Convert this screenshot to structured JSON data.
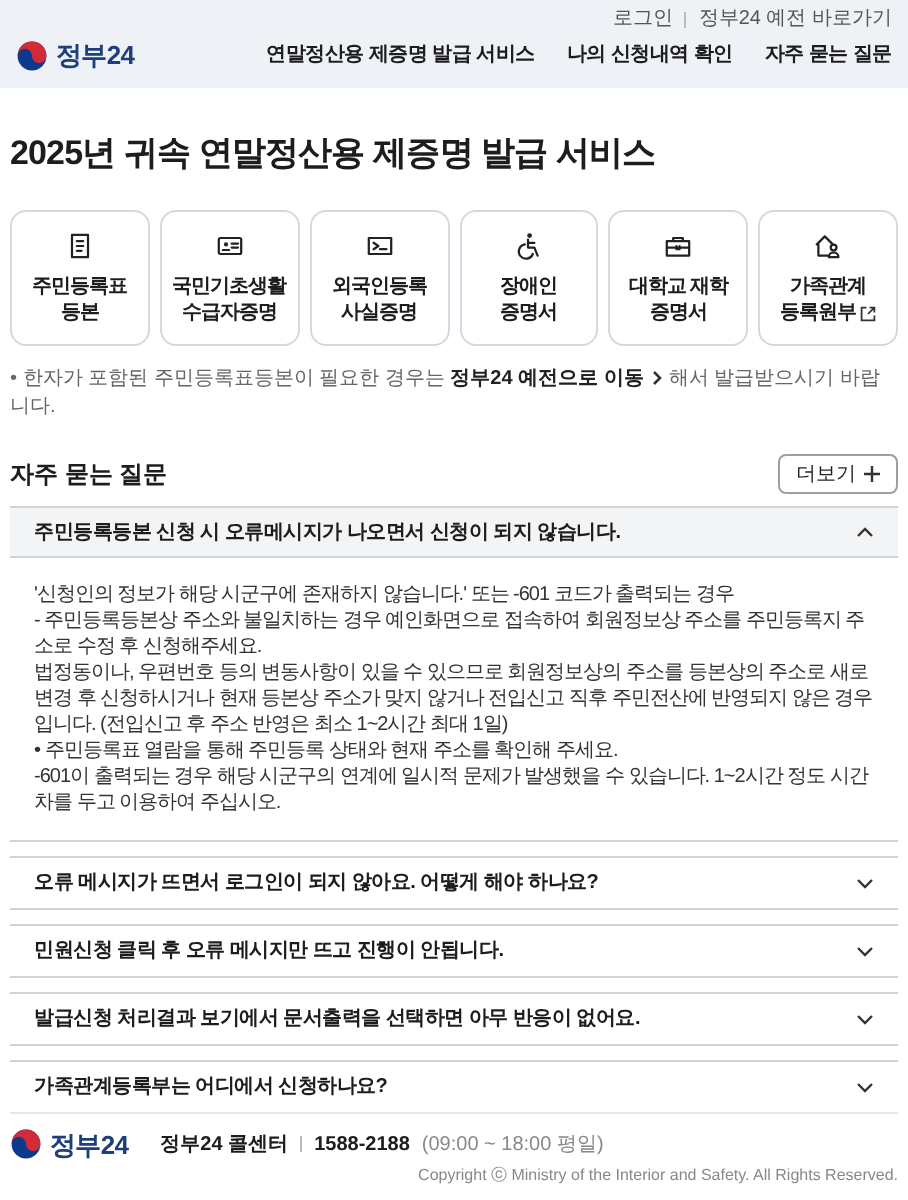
{
  "header": {
    "logo": "정부24",
    "nav": [
      {
        "label": "연말정산용 제증명 발급 서비스"
      },
      {
        "label": "나의 신청내역 확인"
      },
      {
        "label": "자주 묻는 질문"
      }
    ],
    "utility_links": [
      "로그인",
      "정부24 예전 바로가기"
    ]
  },
  "page_title": "2025년 귀속 연말정산용 제증명 발급 서비스",
  "services": [
    {
      "lines": [
        "주민등록표",
        "등본"
      ],
      "external": false
    },
    {
      "lines": [
        "국민기초생활",
        "수급자증명"
      ],
      "external": false
    },
    {
      "lines": [
        "외국인등록",
        "사실증명"
      ],
      "external": false
    },
    {
      "lines": [
        "장애인",
        "증명서"
      ],
      "external": false
    },
    {
      "lines": [
        "대학교 재학",
        "증명서"
      ],
      "external": false
    },
    {
      "lines": [
        "가족관계",
        "등록원부"
      ],
      "external": true
    }
  ],
  "notice": {
    "before": "• 한자가 포함된 주민등록표등본이 필요한 경우는",
    "link": "정부24 예전으로 이동",
    "after": "해서 발급받으시기 바랍니다."
  },
  "faq": {
    "title": "자주 묻는 질문",
    "more_button": "더보기",
    "items": [
      {
        "question": "주민등록등본 신청 시 오류메시지가 나오면서 신청이 되지 않습니다.",
        "expanded": true,
        "answer": [
          "'신청인의 정보가 해당 시군구에 존재하지 않습니다.' 또는 -601 코드가 출력되는 경우",
          " - 주민등록등본상 주소와 불일치하는 경우 예인화면으로 접속하여 회원정보상 주소를 주민등록지 주소로 수정 후 신청해주세요.",
          "법정동이나, 우편번호 등의 변동사항이 있을 수 있으므로 회원정보상의 주소를 등본상의 주소로 새로 변경 후 신청하시거나 현재 등본상 주소가 맞지 않거나 전입신고 직후 주민전산에 반영되지 않은 경우입니다. (전입신고 후 주소 반영은 최소 1~2시간 최대 1일)",
          "• 주민등록표 열람을 통해 주민등록 상태와 현재 주소를 확인해 주세요.",
          "-601이 출력되는 경우 해당 시군구의 연계에 일시적 문제가 발생했을 수 있습니다. 1~2시간 정도 시간차를 두고 이용하여 주십시오."
        ]
      },
      {
        "question": "오류 메시지가 뜨면서 로그인이 되지 않아요. 어떻게 해야 하나요?",
        "expanded": false
      },
      {
        "question": "민원신청 클릭 후 오류 메시지만 뜨고 진행이 안됩니다.",
        "expanded": false
      },
      {
        "question": "발급신청 처리결과 보기에서 문서출력을 선택하면 아무 반응이 없어요.",
        "expanded": false
      },
      {
        "question": "가족관계등록부는 어디에서 신청하나요?",
        "expanded": false
      }
    ]
  },
  "footer": {
    "logo": "정부24",
    "call_center": "정부24 콜센터",
    "phone": "1588-2188",
    "hours": "(09:00 ~ 18:00 평일)",
    "copyright": "Copyright ⓒ Ministry of the Interior and Safety. All Rights Reserved."
  }
}
